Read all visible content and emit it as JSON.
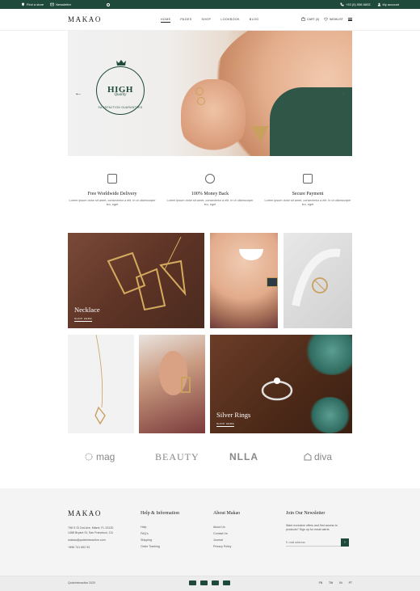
{
  "topbar": {
    "find_store": "Find a store",
    "newsletter": "Newsletter",
    "phone": "+33 (0) 558 6833",
    "account": "My account"
  },
  "header": {
    "logo": "MAKAO",
    "nav": [
      "HOME",
      "PAGES",
      "SHOP",
      "LOOKBOOK",
      "BLOG"
    ],
    "cart": "CART (0)",
    "wishlist": "WISHLIST"
  },
  "hero": {
    "badge_high": "HIGH",
    "badge_quality": "Quality",
    "badge_sub": "SATISFACTION GUARANTEED",
    "prev": "←",
    "next": "→"
  },
  "features": [
    {
      "icon": "delivery-icon",
      "title": "Free Worldwide Delivery",
      "text": "Lorem ipsum dolor sit amet, consectetur a elit. In ut ullamcorper leo, eget"
    },
    {
      "icon": "piggy-bank-icon",
      "title": "100% Money Back",
      "text": "Lorem ipsum dolor sit amet, consectetur a elit. In ut ullamcorper leo, eget"
    },
    {
      "icon": "credit-card-icon",
      "title": "Secure Payment",
      "text": "Lorem ipsum dolor sit amet, consectetur a elit. In ut ullamcorper leo, eget"
    }
  ],
  "tiles": {
    "necklace_label": "Necklace",
    "necklace_shop": "SHOP HERE",
    "rings_label": "Silver Rings",
    "rings_shop": "SHOP HERE"
  },
  "brands": [
    "mag",
    "BEAUTY",
    "NLLA",
    "diva"
  ],
  "footer": {
    "logo": "MAKAO",
    "address_1": "798 S St 2nd Ave, Miami, FL 33130",
    "address_2": "1488 Bryant St, San Francisco, CA",
    "email": "makao@qodeinteractive.com",
    "phone": "+896 741 852 93",
    "help_title": "Help & Information",
    "help_items": [
      "Help",
      "FAQ's",
      "Shipping",
      "Order Tracking"
    ],
    "about_title": "About Makao",
    "about_items": [
      "About Us",
      "Contact Us",
      "Journal",
      "Privacy Policy"
    ],
    "newsletter_title": "Join Our Newsletter",
    "newsletter_text": "Want exclusive offers and first access to products? Sign up for email alerts",
    "newsletter_placeholder": "E-mail address",
    "newsletter_button": "›"
  },
  "bottom": {
    "copyright": "Qodeinteractive 2020",
    "social": [
      "FB",
      "TW",
      "IN",
      "PT"
    ]
  },
  "colors": {
    "brand_green": "#1f4a3b"
  }
}
